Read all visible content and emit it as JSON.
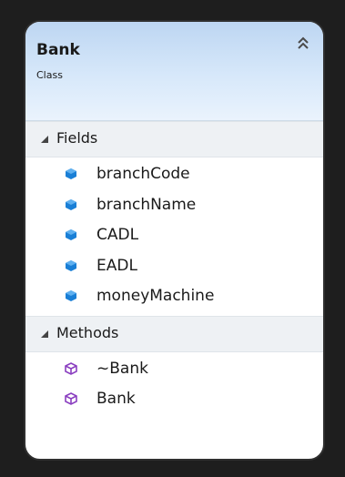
{
  "class_box": {
    "name": "Bank",
    "stereotype": "Class",
    "collapse_icon": "double-chevron-up-icon"
  },
  "sections": {
    "fields": {
      "label": "Fields",
      "icon": "field-cube-icon",
      "icon_color": "#1a7fd6",
      "items": [
        "branchCode",
        "branchName",
        "CADL",
        "EADL",
        "moneyMachine"
      ]
    },
    "methods": {
      "label": "Methods",
      "icon": "method-cube-icon",
      "icon_color": "#8a3fc0",
      "items": [
        "~Bank",
        "Bank"
      ]
    }
  }
}
